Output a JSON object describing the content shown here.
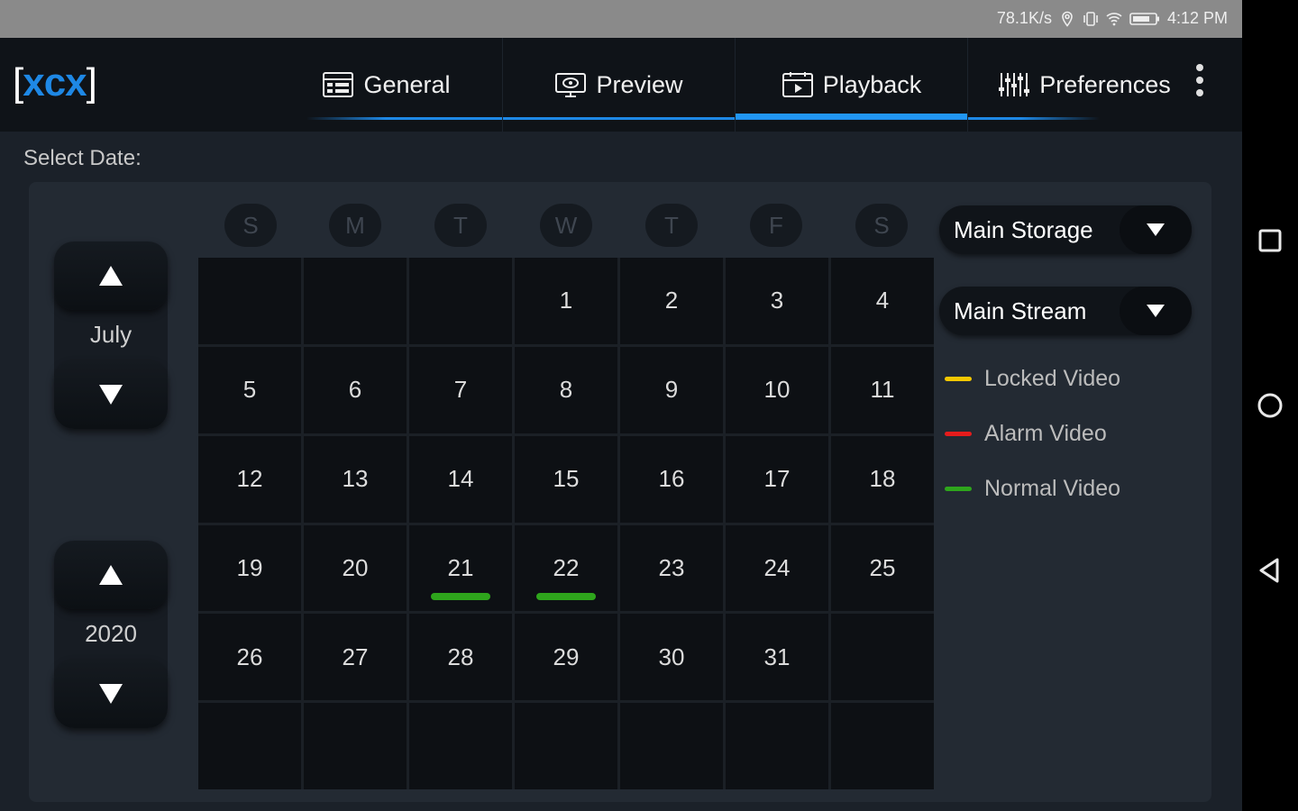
{
  "status_bar": {
    "net_speed": "78.1K/s",
    "time": "4:12 PM",
    "icons": [
      "location-icon",
      "vibrate-icon",
      "wifi-icon",
      "battery-icon"
    ]
  },
  "app": {
    "logo_open": "[",
    "logo_text": "xcx",
    "logo_close": "]",
    "tabs": [
      {
        "label": "General",
        "icon": "general-icon",
        "active": false
      },
      {
        "label": "Preview",
        "icon": "preview-icon",
        "active": false
      },
      {
        "label": "Playback",
        "icon": "playback-icon",
        "active": true
      },
      {
        "label": "Preferences",
        "icon": "preferences-icon",
        "active": false
      }
    ],
    "accent_color": "#2196f3"
  },
  "select_date_label": "Select Date:",
  "month_stepper": {
    "value": "July"
  },
  "year_stepper": {
    "value": "2020"
  },
  "weekdays": [
    "S",
    "M",
    "T",
    "W",
    "T",
    "F",
    "S"
  ],
  "calendar": {
    "cells": [
      "",
      "",
      "",
      "1",
      "2",
      "3",
      "4",
      "5",
      "6",
      "7",
      "8",
      "9",
      "10",
      "11",
      "12",
      "13",
      "14",
      "15",
      "16",
      "17",
      "18",
      "19",
      "20",
      "21",
      "22",
      "23",
      "24",
      "25",
      "26",
      "27",
      "28",
      "29",
      "30",
      "31",
      "",
      "",
      "",
      "",
      "",
      "",
      "",
      ""
    ],
    "normal_video_days": [
      "21",
      "22"
    ]
  },
  "storage_dropdown": {
    "value": "Main Storage"
  },
  "stream_dropdown": {
    "value": "Main Stream"
  },
  "legend": [
    {
      "label": "Locked Video",
      "color": "#f5c800"
    },
    {
      "label": "Alarm Video",
      "color": "#e51c1c"
    },
    {
      "label": "Normal Video",
      "color": "#2ea51c"
    }
  ],
  "system_nav": [
    "recents-icon",
    "home-icon",
    "back-icon"
  ]
}
